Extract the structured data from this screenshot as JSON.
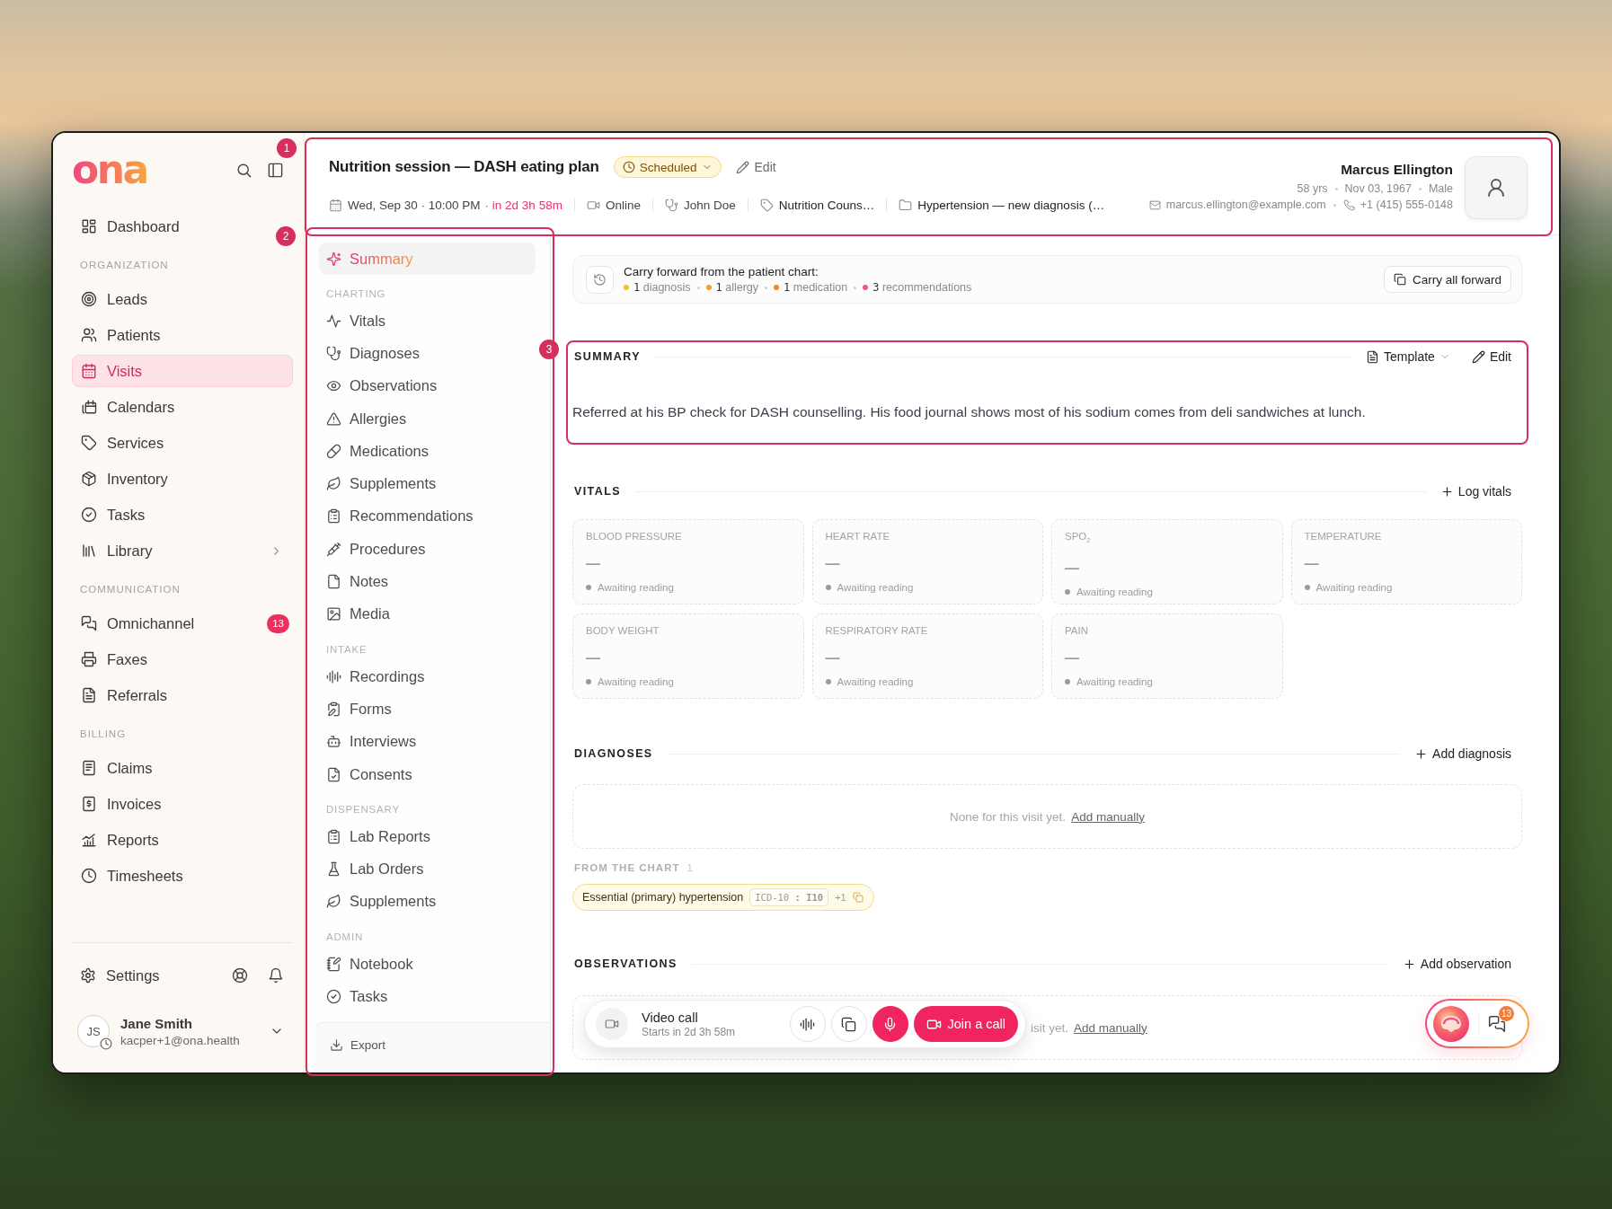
{
  "annotations": [
    {
      "label": "1"
    },
    {
      "label": "2"
    },
    {
      "label": "3"
    }
  ],
  "sidebar": {
    "logo": "ona",
    "nav": [
      {
        "kind": "item",
        "label": "Dashboard",
        "selected": false
      },
      {
        "kind": "heading",
        "label": "ORGANIZATION"
      },
      {
        "kind": "item",
        "label": "Leads",
        "selected": false
      },
      {
        "kind": "item",
        "label": "Patients",
        "selected": false
      },
      {
        "kind": "item",
        "label": "Visits",
        "selected": true
      },
      {
        "kind": "item",
        "label": "Calendars",
        "selected": false
      },
      {
        "kind": "item",
        "label": "Services",
        "selected": false
      },
      {
        "kind": "item",
        "label": "Inventory",
        "selected": false
      },
      {
        "kind": "item",
        "label": "Tasks",
        "selected": false
      },
      {
        "kind": "group",
        "label": "Library",
        "selected": false,
        "expanded": false
      },
      {
        "kind": "heading",
        "label": "COMMUNICATION"
      },
      {
        "kind": "item",
        "label": "Omnichannel",
        "selected": false,
        "badge": "13"
      },
      {
        "kind": "item",
        "label": "Faxes",
        "selected": false
      },
      {
        "kind": "item",
        "label": "Referrals",
        "selected": false
      },
      {
        "kind": "heading",
        "label": "BILLING"
      },
      {
        "kind": "item",
        "label": "Claims",
        "selected": false
      },
      {
        "kind": "item",
        "label": "Invoices",
        "selected": false
      },
      {
        "kind": "item",
        "label": "Reports",
        "selected": false
      },
      {
        "kind": "item",
        "label": "Timesheets",
        "selected": false
      }
    ],
    "settings": "Settings",
    "user": {
      "initials": "JS",
      "name": "Jane Smith",
      "email": "kacper+1@ona.health"
    }
  },
  "visit": {
    "title": "Nutrition session — DASH eating plan",
    "status": "Scheduled",
    "edit": "Edit",
    "datetime": "Wed, Sep 30 · 10:00 PM",
    "countdown": "· in 2d 3h 58m",
    "mode": "Online",
    "provider": "John Doe",
    "service": "Nutrition Couns…",
    "case": "Hypertension — new diagnosis (…"
  },
  "patient": {
    "name": "Marcus Ellington",
    "age": "58 yrs",
    "dob": "Nov 03, 1967",
    "sex": "Male",
    "email": "marcus.ellington@example.com",
    "phone": "+1 (415) 555-0148"
  },
  "chart_nav": {
    "items": [
      {
        "kind": "item",
        "label": "Summary",
        "selected": true
      },
      {
        "kind": "heading",
        "label": "CHARTING"
      },
      {
        "kind": "item",
        "label": "Vitals",
        "selected": false
      },
      {
        "kind": "item",
        "label": "Diagnoses",
        "selected": false
      },
      {
        "kind": "item",
        "label": "Observations",
        "selected": false
      },
      {
        "kind": "item",
        "label": "Allergies",
        "selected": false
      },
      {
        "kind": "item",
        "label": "Medications",
        "selected": false
      },
      {
        "kind": "item",
        "label": "Supplements",
        "selected": false
      },
      {
        "kind": "item",
        "label": "Recommendations",
        "selected": false
      },
      {
        "kind": "item",
        "label": "Procedures",
        "selected": false
      },
      {
        "kind": "item",
        "label": "Notes",
        "selected": false
      },
      {
        "kind": "item",
        "label": "Media",
        "selected": false
      },
      {
        "kind": "heading",
        "label": "INTAKE"
      },
      {
        "kind": "item",
        "label": "Recordings",
        "selected": false
      },
      {
        "kind": "item",
        "label": "Forms",
        "selected": false
      },
      {
        "kind": "item",
        "label": "Interviews",
        "selected": false
      },
      {
        "kind": "item",
        "label": "Consents",
        "selected": false
      },
      {
        "kind": "heading",
        "label": "DISPENSARY"
      },
      {
        "kind": "item",
        "label": "Lab Reports",
        "selected": false
      },
      {
        "kind": "item",
        "label": "Lab Orders",
        "selected": false
      },
      {
        "kind": "item",
        "label": "Supplements",
        "selected": false
      },
      {
        "kind": "heading",
        "label": "ADMIN"
      },
      {
        "kind": "item",
        "label": "Notebook",
        "selected": false
      },
      {
        "kind": "item",
        "label": "Tasks",
        "selected": false
      }
    ],
    "export": "Export"
  },
  "carry_forward": {
    "title": "Carry forward from the patient chart:",
    "items": [
      {
        "count": "1",
        "label": "diagnosis",
        "color": "#f5c326"
      },
      {
        "count": "1",
        "label": "allergy",
        "color": "#f59e20"
      },
      {
        "count": "1",
        "label": "medication",
        "color": "#f08a1c"
      },
      {
        "count": "3",
        "label": "recommendations",
        "color": "#f0577a"
      }
    ],
    "action": "Carry all forward"
  },
  "summary": {
    "heading": "SUMMARY",
    "template": "Template",
    "edit": "Edit",
    "text": "Referred at his BP check for DASH counselling. His food journal shows most of his sodium comes from deli sandwiches at lunch."
  },
  "vitals": {
    "heading": "VITALS",
    "action": "Log vitals",
    "cards": [
      {
        "label": "BLOOD PRESSURE",
        "value": "—",
        "status": "Awaiting reading"
      },
      {
        "label": "HEART RATE",
        "value": "—",
        "status": "Awaiting reading"
      },
      {
        "label": "SPO$_{2}$",
        "value": "—",
        "status": "Awaiting reading"
      },
      {
        "label": "TEMPERATURE",
        "value": "—",
        "status": "Awaiting reading"
      },
      {
        "label": "BODY WEIGHT",
        "value": "—",
        "status": "Awaiting reading"
      },
      {
        "label": "RESPIRATORY RATE",
        "value": "—",
        "status": "Awaiting reading"
      },
      {
        "label": "PAIN",
        "value": "—",
        "status": "Awaiting reading"
      }
    ]
  },
  "diagnoses": {
    "heading": "DIAGNOSES",
    "action": "Add diagnosis",
    "empty": "None for this visit yet.",
    "link": "Add manually",
    "from_chart": {
      "label": "FROM THE CHART",
      "count": "1",
      "chips": [
        {
          "name": "Essential (primary) hypertension",
          "code": "ICD-10 **: I10**",
          "extra": "+1"
        }
      ]
    }
  },
  "observations": {
    "heading": "OBSERVATIONS",
    "action": "Add observation",
    "empty": "isit yet.",
    "link": "Add manually"
  },
  "video_call": {
    "title": "Video call",
    "subtitle": "Starts in 2d 3h 58m",
    "join": "Join a call"
  },
  "assistant": {
    "badge": "13"
  }
}
